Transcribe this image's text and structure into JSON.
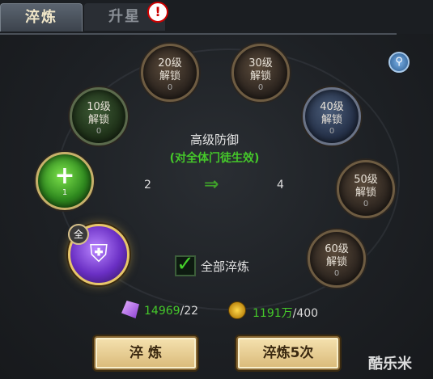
{
  "tabs": [
    {
      "label": "淬炼",
      "active": true
    },
    {
      "label": "升星",
      "active": false
    }
  ],
  "center": {
    "title": "高级防御",
    "subtitle": "(对全体门徒生效)",
    "from_value": "2",
    "to_value": "4"
  },
  "nodes": {
    "n10": {
      "level": "10级",
      "status": "解锁",
      "count": "0"
    },
    "n20": {
      "level": "20级",
      "status": "解锁",
      "count": "0"
    },
    "n30": {
      "level": "30级",
      "status": "解锁",
      "count": "0"
    },
    "n40": {
      "level": "40级",
      "status": "解锁",
      "count": "0"
    },
    "n50": {
      "level": "50级",
      "status": "解锁",
      "count": "0"
    },
    "n60": {
      "level": "60级",
      "status": "解锁",
      "count": "0"
    },
    "heal": {
      "count": "1"
    },
    "defense": {
      "badge": "全"
    }
  },
  "all_refine": {
    "label": "全部淬炼",
    "checked": true
  },
  "resources": {
    "gem": {
      "have": "14969",
      "need": "/22"
    },
    "coin": {
      "have": "1191万",
      "need": "/400"
    }
  },
  "buttons": {
    "refine": "淬 炼",
    "refine5": "淬炼5次"
  },
  "watermark": "酷乐米",
  "alert_glyph": "!",
  "icons": {
    "zoom": "magnifier-icon",
    "heal": "plus-icon",
    "defense": "shield-icon"
  },
  "colors": {
    "accent_green": "#45c82a",
    "button_gold": "#d9b978"
  }
}
